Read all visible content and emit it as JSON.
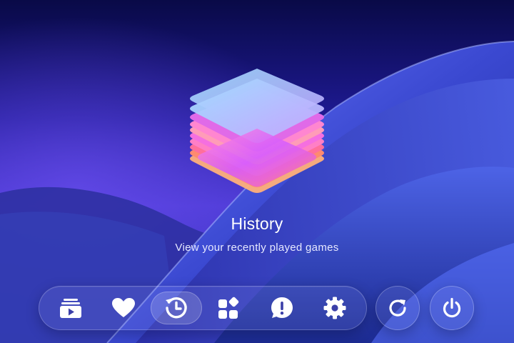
{
  "screen": {
    "title": "History",
    "subtitle": "View your recently played games"
  },
  "dock": {
    "items": [
      {
        "id": "library",
        "icon": "play-stack-icon",
        "active": false
      },
      {
        "id": "favorites",
        "icon": "heart-icon",
        "active": false
      },
      {
        "id": "history",
        "icon": "history-icon",
        "active": true
      },
      {
        "id": "apps",
        "icon": "apps-grid-icon",
        "active": false
      },
      {
        "id": "feedback",
        "icon": "alert-bubble-icon",
        "active": false
      },
      {
        "id": "settings",
        "icon": "gear-icon",
        "active": false
      }
    ],
    "extra_buttons": [
      {
        "id": "refresh",
        "icon": "refresh-icon"
      },
      {
        "id": "power",
        "icon": "power-icon"
      }
    ]
  },
  "colors": {
    "background_top": "#0a0b4d",
    "background_mid": "#3f2fc6",
    "wave": "#3d4fd6",
    "icon": "#ffffff"
  }
}
